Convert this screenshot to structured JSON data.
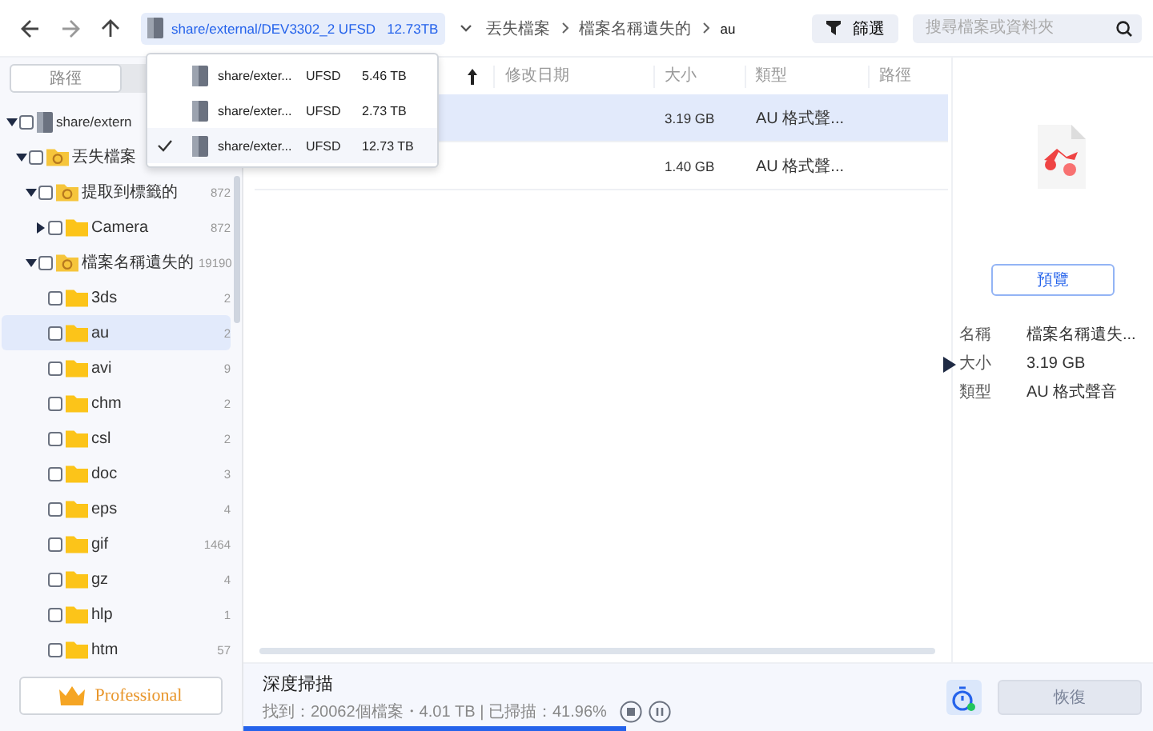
{
  "nav": {
    "drive": {
      "path": "share/external/DEV3302_2 UFSD",
      "size": "12.73TB"
    },
    "breadcrumb": [
      "丟失檔案",
      "檔案名稱遺失的",
      "au"
    ]
  },
  "filter_button": "篩選",
  "search": {
    "placeholder": "搜尋檔案或資料夾"
  },
  "drive_menu": [
    {
      "name": "share/exter...",
      "fs": "UFSD",
      "size": "5.46 TB",
      "selected": false
    },
    {
      "name": "share/exter...",
      "fs": "UFSD",
      "size": "2.73 TB",
      "selected": false
    },
    {
      "name": "share/exter...",
      "fs": "UFSD",
      "size": "12.73 TB",
      "selected": true
    }
  ],
  "sidebar_tabs": [
    {
      "label": "路徑",
      "selected": true
    }
  ],
  "tree": [
    {
      "label": "share/extern",
      "kind": "drive",
      "expanded": true,
      "checked": false,
      "selected": false,
      "children": [
        {
          "label": "丟失檔案",
          "kind": "special",
          "expanded": true,
          "checked": false,
          "selected": false,
          "children": [
            {
              "label": "提取到標籤的",
              "kind": "special",
              "count": "872",
              "expanded": true,
              "checked": false,
              "selected": false,
              "children": [
                {
                  "label": "Camera",
                  "kind": "folder",
                  "count": "872",
                  "expanded": false,
                  "checked": false,
                  "selected": false
                }
              ]
            },
            {
              "label": "檔案名稱遺失的",
              "kind": "special",
              "count": "19190",
              "expanded": true,
              "checked": false,
              "selected": false,
              "children": [
                {
                  "label": "3ds",
                  "kind": "folder",
                  "count": "2",
                  "checked": false,
                  "selected": false
                },
                {
                  "label": "au",
                  "kind": "folder",
                  "count": "2",
                  "checked": false,
                  "selected": true
                },
                {
                  "label": "avi",
                  "kind": "folder",
                  "count": "9",
                  "checked": false,
                  "selected": false
                },
                {
                  "label": "chm",
                  "kind": "folder",
                  "count": "2",
                  "checked": false,
                  "selected": false
                },
                {
                  "label": "csl",
                  "kind": "folder",
                  "count": "2",
                  "checked": false,
                  "selected": false
                },
                {
                  "label": "doc",
                  "kind": "folder",
                  "count": "3",
                  "checked": false,
                  "selected": false
                },
                {
                  "label": "eps",
                  "kind": "folder",
                  "count": "4",
                  "checked": false,
                  "selected": false
                },
                {
                  "label": "gif",
                  "kind": "folder",
                  "count": "1464",
                  "checked": false,
                  "selected": false
                },
                {
                  "label": "gz",
                  "kind": "folder",
                  "count": "4",
                  "checked": false,
                  "selected": false
                },
                {
                  "label": "hlp",
                  "kind": "folder",
                  "count": "1",
                  "checked": false,
                  "selected": false
                },
                {
                  "label": "htm",
                  "kind": "folder",
                  "count": "57",
                  "checked": false,
                  "selected": false
                }
              ]
            }
          ]
        }
      ]
    }
  ],
  "professional_button": "Professional",
  "table": {
    "columns": [
      "修改日期",
      "大小",
      "類型",
      "路徑"
    ],
    "rows": [
      {
        "size": "3.19 GB",
        "type": "AU 格式聲...",
        "selected": true
      },
      {
        "size": "1.40 GB",
        "type": "AU 格式聲...",
        "selected": false
      }
    ]
  },
  "preview": {
    "button": "預覽",
    "details": [
      {
        "label": "名稱",
        "value": "檔案名稱遺失..."
      },
      {
        "label": "大小",
        "value": "3.19 GB"
      },
      {
        "label": "類型",
        "value": "AU 格式聲音"
      }
    ]
  },
  "scan": {
    "title": "深度掃描",
    "status": "找到：20062個檔案・4.01 TB | 已掃描：41.96%",
    "level": 0.42
  },
  "recover_button": {
    "label": "恢復",
    "disabled": true
  }
}
